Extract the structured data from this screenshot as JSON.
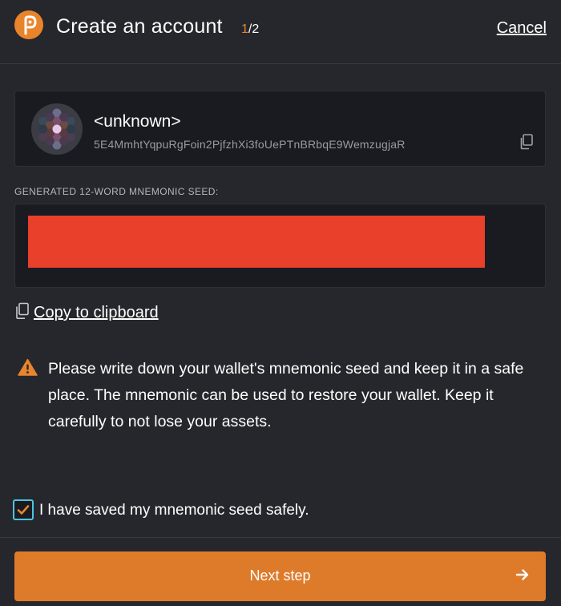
{
  "header": {
    "title": "Create an account",
    "step_current": "1",
    "step_total": "/2",
    "cancel_label": "Cancel",
    "logo_icon": "polkadot-logo-icon"
  },
  "account": {
    "name": "<unknown>",
    "address": "5E4MmhtYqpuRgFoin2PjfzhXi3foUePTnBRbqE9WemzugjaR",
    "copy_icon": "copy-icon"
  },
  "seed": {
    "label": "GENERATED 12-WORD MNEMONIC SEED:",
    "redaction_color": "#e8402a"
  },
  "copy_clipboard_label": "Copy to clipboard",
  "warning": {
    "icon": "warning-icon",
    "text": "Please write down your wallet's mnemonic seed and keep it in a safe place. The mnemonic can be used to restore your wallet. Keep it carefully to not lose your assets."
  },
  "confirm": {
    "checked": true,
    "label": "I have saved my mnemonic seed safely."
  },
  "next_button": {
    "label": "Next step",
    "icon": "arrow-right-icon"
  },
  "colors": {
    "accent": "#e8852c",
    "background": "#26272c",
    "card": "#1a1b20",
    "checkbox_border": "#4fc3e0"
  }
}
